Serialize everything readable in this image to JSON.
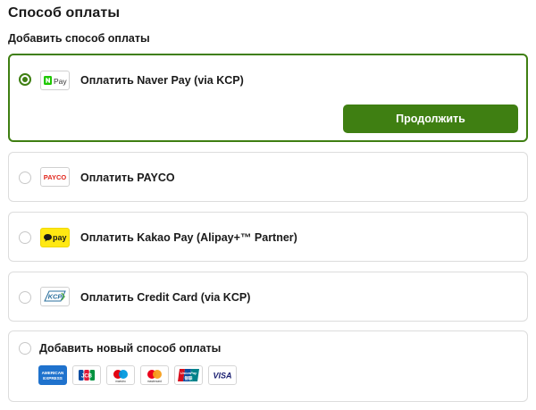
{
  "page": {
    "title": "Способ оплаты",
    "subtitle": "Добавить способ оплаты"
  },
  "methods": [
    {
      "label": "Оплатить Naver Pay (via KCP)",
      "icon": "naver-pay-logo",
      "selected": true,
      "logo_text": "Pay"
    },
    {
      "label": "Оплатить PAYCO",
      "icon": "payco-logo",
      "selected": false,
      "logo_text": "PAYCO"
    },
    {
      "label": "Оплатить Kakao Pay (Alipay+™ Partner)",
      "icon": "kakao-pay-logo",
      "selected": false,
      "logo_text": "pay"
    },
    {
      "label": "Оплатить Credit Card (via KCP)",
      "icon": "kcp-logo",
      "selected": false,
      "logo_text": "KCP"
    }
  ],
  "continue_button": {
    "label": "Продолжить"
  },
  "add_new": {
    "label": "Добавить новый способ оплаты",
    "cards": [
      {
        "icon": "amex-icon",
        "line1": "AMERICAN",
        "line2": "EXPRESS"
      },
      {
        "icon": "jcb-icon",
        "text": "JCB"
      },
      {
        "icon": "maestro-icon",
        "text": "maestro"
      },
      {
        "icon": "mastercard-icon",
        "text": "mastercard"
      },
      {
        "icon": "unionpay-icon",
        "line1": "UnionPay",
        "line2": "银联"
      },
      {
        "icon": "visa-icon",
        "text": "VISA"
      }
    ]
  },
  "colors": {
    "accent": "#3f7f12",
    "border": "#dcdcdc",
    "payco_red": "#e1251b",
    "kakao_yellow": "#ffe812"
  }
}
